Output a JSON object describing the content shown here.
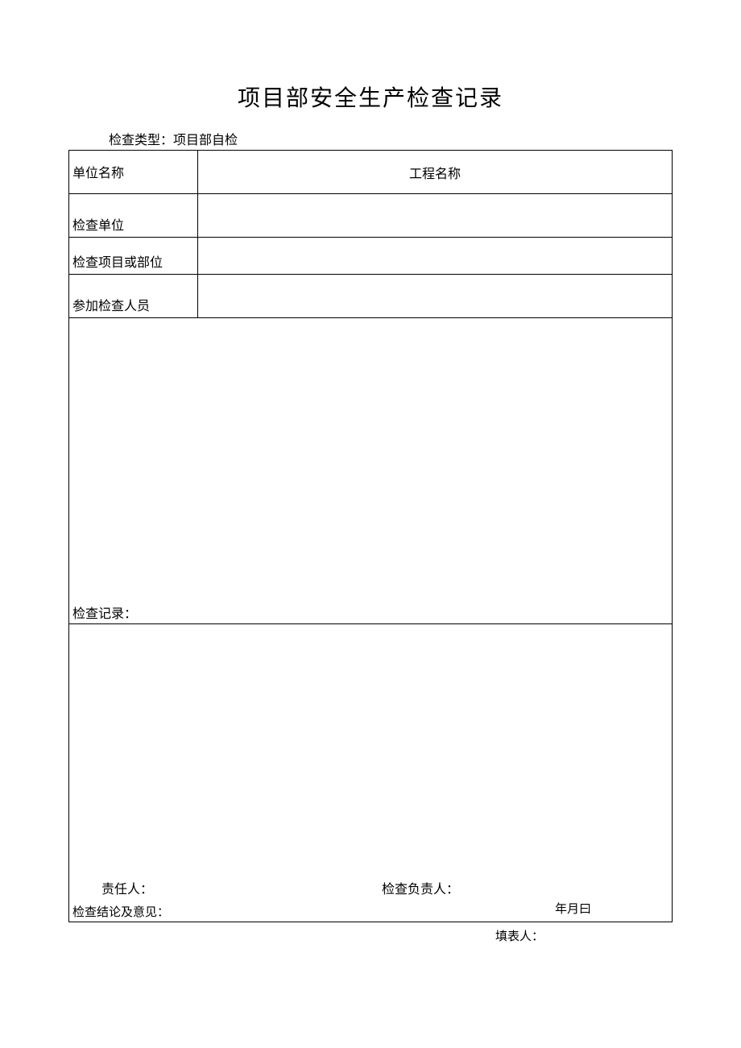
{
  "title": "项目部安全生产检查记录",
  "subtitle": "检查类型：项目部自检",
  "labels": {
    "unit_name": "单位名称",
    "project_name": "工程名称",
    "inspect_unit": "检查单位",
    "inspect_item": "检查项目或部位",
    "participants": "参加检查人员",
    "record": "检查记录：",
    "conclusion": "检查结论及意见：",
    "responsible": "责任人：",
    "inspector_lead": "检查负责人：",
    "date": "年月曰",
    "filler": "填表人："
  },
  "values": {
    "unit_name": "",
    "project_name": "",
    "inspect_unit": "",
    "inspect_item": "",
    "participants": "",
    "record": "",
    "conclusion": "",
    "responsible": "",
    "inspector_lead": "",
    "date": "",
    "filler": ""
  }
}
